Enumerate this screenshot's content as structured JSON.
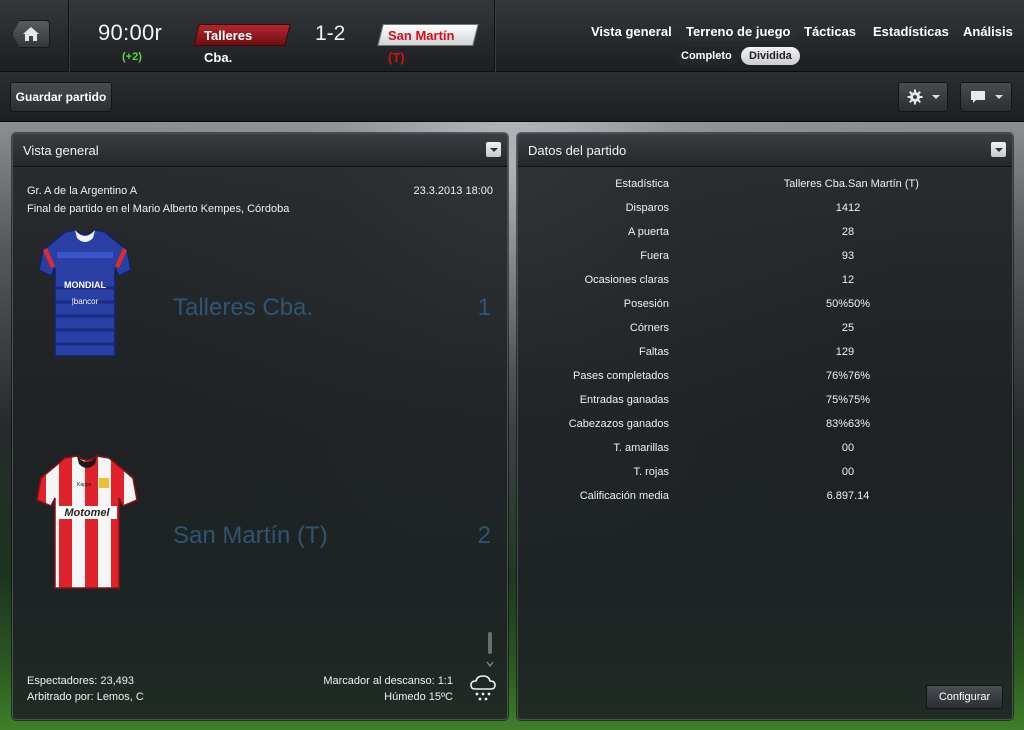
{
  "header": {
    "clock": "90:00r",
    "added_time": "(+2)",
    "home_team": "Talleres Cba.",
    "score": "1-2",
    "away_team": "San Martín (T)",
    "nav": [
      "Vista general",
      "Terreno de juego",
      "Tácticas",
      "Estadísticas",
      "Análisis"
    ],
    "active_nav": "Terreno de juego",
    "subtabs": [
      "Completo",
      "Dividida"
    ],
    "active_subtab": "Dividida"
  },
  "toolbar": {
    "save_label": "Guardar partido"
  },
  "overview": {
    "title": "Vista general",
    "competition": "Gr. A de la Argentino A",
    "datetime": "23.3.2013 18:00",
    "venue": "Final de partido en el Mario Alberto Kempes, Córdoba",
    "home_team": "Talleres Cba.",
    "home_score": "1",
    "away_team": "San Martín (T)",
    "away_score": "2",
    "spectators": "Espectadores: 23,493",
    "referee": "Arbitrado por: Lemos, C",
    "halftime": "Marcador al descanso: 1:1",
    "weather": "Húmedo 15ºC",
    "home_kit_text": [
      "MONDIAL",
      "bancor"
    ],
    "away_kit_text": [
      "Motomel",
      "Kappa"
    ]
  },
  "stats": {
    "title": "Datos del partido",
    "header": [
      "Estadística",
      "Talleres Cba.",
      "San Martín (T)"
    ],
    "rows": [
      [
        "Disparos",
        "14",
        "12"
      ],
      [
        "A puerta",
        "2",
        "8"
      ],
      [
        "Fuera",
        "9",
        "3"
      ],
      [
        "Ocasiones claras",
        "1",
        "2"
      ],
      [
        "Posesión",
        "50%",
        "50%"
      ],
      [
        "Córners",
        "2",
        "5"
      ],
      [
        "Faltas",
        "12",
        "9"
      ],
      [
        "Pases completados",
        "76%",
        "76%"
      ],
      [
        "Entradas ganadas",
        "75%",
        "75%"
      ],
      [
        "Cabezazos ganados",
        "83%",
        "63%"
      ],
      [
        "T. amarillas",
        "0",
        "0"
      ],
      [
        "T. rojas",
        "0",
        "0"
      ],
      [
        "Calificación media",
        "6.89",
        "7.14"
      ]
    ],
    "configure_label": "Configurar"
  },
  "colors": {
    "home": "#b3262e",
    "away": "#d4101b",
    "added_time": "#5fd352",
    "team_name_faded": "#2f5573"
  }
}
